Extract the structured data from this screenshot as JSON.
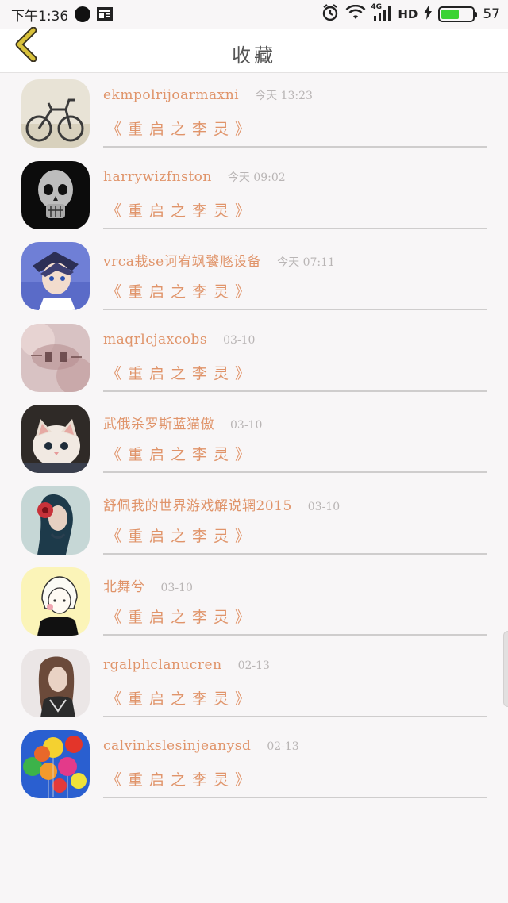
{
  "status_bar": {
    "time": "下午1:36",
    "network": "4G",
    "hd": "HD",
    "battery_level": "57",
    "battery_fraction": 0.57,
    "battery_color": "#3bd334"
  },
  "header": {
    "back_icon": "chevron-left-icon",
    "back_color": "#d8c13a",
    "title": "收藏"
  },
  "colors": {
    "accent": "#e0946a",
    "timestamp": "#b9b5b5",
    "divider": "#cfcdcd",
    "background": "#f8f6f7"
  },
  "favorites": [
    {
      "username": "ekmpolrijoarmaxni",
      "timestamp": "今天 13:23",
      "book": "《重启之李灵》",
      "avatar": "bicycle-photo"
    },
    {
      "username": "harrywizfnston",
      "timestamp": "今天 09:02",
      "book": "《重启之李灵》",
      "avatar": "skull-photo"
    },
    {
      "username": "vrca栽se诃宥飒饕豗设备",
      "timestamp": "今天 07:11",
      "book": "《重启之李灵》",
      "avatar": "anime-boy-photo"
    },
    {
      "username": "maqrlcjaxcobs",
      "timestamp": "03-10",
      "book": "《重启之李灵》",
      "avatar": "text-collage-photo"
    },
    {
      "username": "武俄杀罗斯蓝猫傲",
      "timestamp": "03-10",
      "book": "《重启之李灵》",
      "avatar": "kitten-photo"
    },
    {
      "username": "舒佩我的世界游戏解说辋2015",
      "timestamp": "03-10",
      "book": "《重启之李灵》",
      "avatar": "flower-girl-photo"
    },
    {
      "username": "北舞兮",
      "timestamp": "03-10",
      "book": "《重启之李灵》",
      "avatar": "sketch-girl-photo"
    },
    {
      "username": "rgalphclanucren",
      "timestamp": "02-13",
      "book": "《重启之李灵》",
      "avatar": "woman-portrait-photo"
    },
    {
      "username": "calvinkslesinjeanysd",
      "timestamp": "02-13",
      "book": "《重启之李灵》",
      "avatar": "balloons-photo"
    }
  ]
}
